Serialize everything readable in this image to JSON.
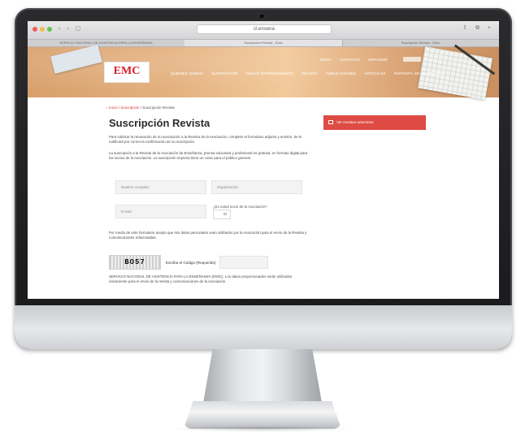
{
  "browser": {
    "url": "cl.ensena",
    "tabs": [
      "SERVICIO NACIONAL DE ASISTENCIA PARA LA ENSEÑANZA",
      "Suscripción Revista - Emic",
      "Suscripción Revista - Emic"
    ]
  },
  "site": {
    "logo_text": "EMC",
    "top_links": [
      "INICIO",
      "CONTACTO",
      "SERVIDOR",
      "CAMPUS"
    ],
    "nav_items": [
      "QUIÉNES SOMOS",
      "SUSCRIPCIÓN",
      "NUEVO ENTRENAMIENTO",
      "REVISTA",
      "PUBLICACIONES",
      "ARTÍCULOS",
      "PARTICIPA EN LA REVISTA"
    ]
  },
  "breadcrumb": {
    "home": "Inicio",
    "section": "Suscripción",
    "current": "Suscripción Revista"
  },
  "page": {
    "title": "Suscripción Revista",
    "intro": "Para solicitar la renovación de su suscripción a la Revista de la Asociación, complete el formulario adjunto y envíelo. Se le notificará por correo la confirmación de su suscripción.",
    "body": "La suscripción a la Revista de la Asociación de Enseñanza, prensa educativa y profesional es gratuita, en formato digital para los socios de la Asociación. La suscripción impresa tiene un costo para el público general.",
    "fields": {
      "name_placeholder": "Nombre completo",
      "org_placeholder": "Organización",
      "email_placeholder": "E-mail",
      "question_label": "¿Es usted socio de la Asociación?",
      "question_value": "Sí"
    },
    "disclaimer": "Por medio de este formulario acepto que mis datos personales sean utilizados por la Asociación para el envío de la Revista y comunicaciones relacionadas.",
    "captcha": {
      "image_text": "BO57",
      "label": "Escriba el Código (Requerido)"
    },
    "footer_text": "SERVICIO NACIONAL DE ASISTENCIA PARA LA ENSEÑANZA (EMIC). Los datos proporcionados serán utilizados únicamente para el envío de la revista y comunicaciones de la Asociación."
  },
  "sidebar": {
    "button_label": "Ver revistas anteriores"
  }
}
